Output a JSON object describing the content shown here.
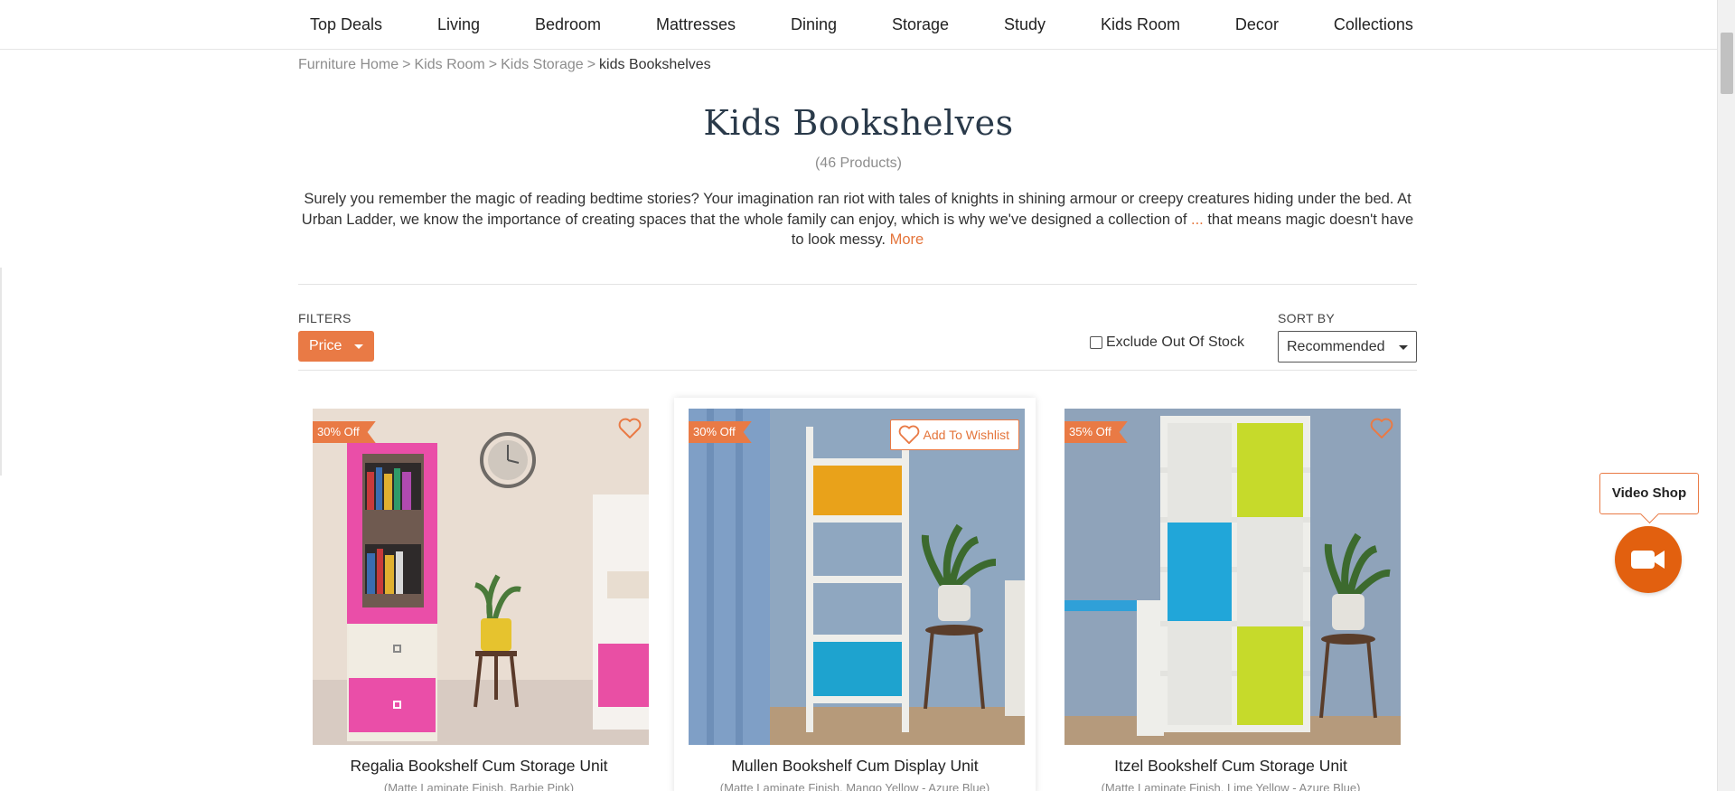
{
  "nav": {
    "items": [
      {
        "label": "Top Deals"
      },
      {
        "label": "Living"
      },
      {
        "label": "Bedroom"
      },
      {
        "label": "Mattresses"
      },
      {
        "label": "Dining"
      },
      {
        "label": "Storage"
      },
      {
        "label": "Study"
      },
      {
        "label": "Kids Room"
      },
      {
        "label": "Decor"
      },
      {
        "label": "Collections"
      }
    ]
  },
  "breadcrumb": {
    "items": [
      {
        "label": "Furniture Home"
      },
      {
        "label": "Kids Room"
      },
      {
        "label": "Kids Storage"
      }
    ],
    "separator": ">",
    "current": "kids Bookshelves"
  },
  "category": {
    "title": "Kids Bookshelves",
    "count": "(46 Products)",
    "description_1": "Surely you remember the magic of reading bedtime stories? Your imagination ran riot with tales of knights in shining armour or creepy creatures hiding under the bed. At Urban Ladder, we know the importance of creating spaces that the whole family can enjoy, which is why we've designed a collection of ",
    "description_ellipsis": "...",
    "description_2": " that means magic doesn't have to look messy. ",
    "more_label": "More"
  },
  "filters": {
    "label": "FILTERS",
    "price_label": "Price",
    "exclude_oos_label": "Exclude Out Of Stock",
    "exclude_oos_checked": false
  },
  "sort": {
    "label": "SORT BY",
    "selected": "Recommended"
  },
  "products": [
    {
      "name": "Regalia Bookshelf Cum Storage Unit",
      "variant": "(Matte Laminate Finish, Barbie Pink)",
      "discount": "30% Off"
    },
    {
      "name": "Mullen Bookshelf Cum Display Unit",
      "variant": "(Matte Laminate Finish, Mango Yellow - Azure Blue)",
      "discount": "30% Off",
      "wishlist_label": "Add To Wishlist"
    },
    {
      "name": "Itzel Bookshelf Cum Storage Unit",
      "variant": "(Matte Laminate Finish, Lime Yellow - Azure Blue)",
      "discount": "35% Off"
    }
  ],
  "video_shop": {
    "label": "Video Shop",
    "icon": "video-camera-icon"
  },
  "colors": {
    "accent": "#e97a45",
    "video_button": "#e2600f",
    "heading": "#2a3a4a"
  }
}
